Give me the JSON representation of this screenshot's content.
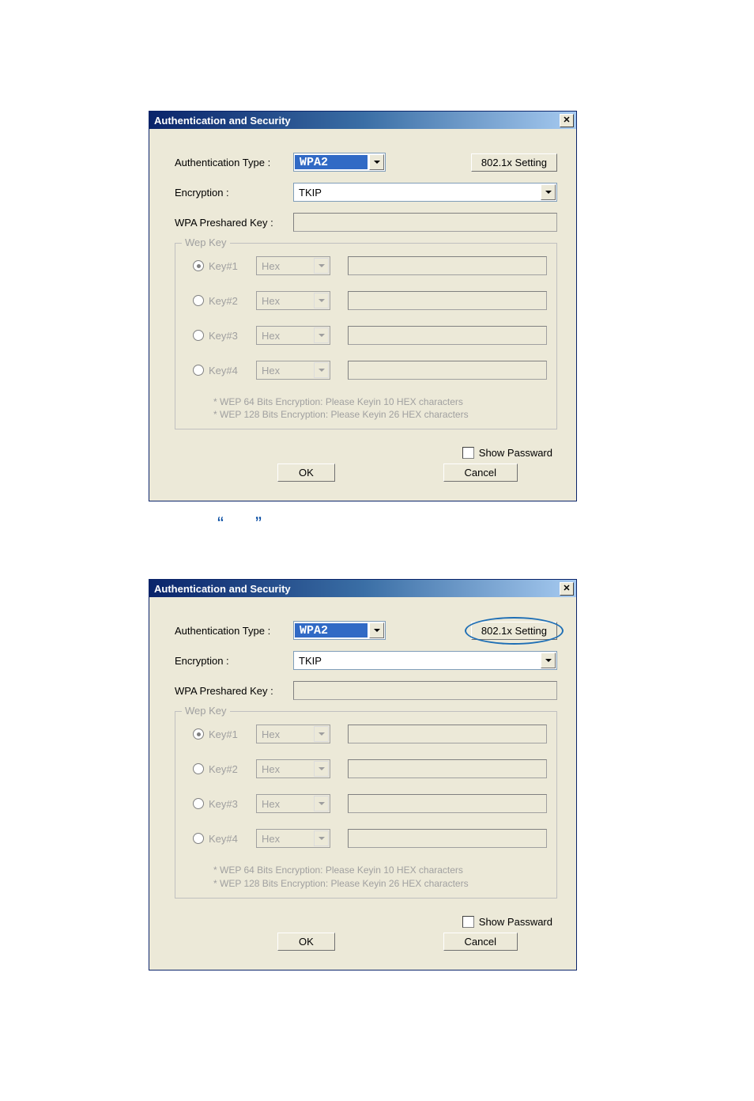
{
  "decor_quotes": {
    "left": "“",
    "right": "”"
  },
  "dialogs": [
    {
      "title": "Authentication and Security",
      "highlight_8021x": false,
      "labels": {
        "auth_type": "Authentication Type :",
        "encryption": "Encryption :",
        "psk": "WPA Preshared Key :",
        "wep_legend": "Wep Key",
        "show_password": "Show Passward",
        "btn_8021x": "802.1x Setting",
        "ok": "OK",
        "cancel": "Cancel"
      },
      "values": {
        "auth_type": "WPA2",
        "encryption": "TKIP",
        "psk": "",
        "show_password_checked": false,
        "selected_wep_index": 0
      },
      "wep_keys": [
        {
          "label": "Key#1",
          "format": "Hex",
          "value": ""
        },
        {
          "label": "Key#2",
          "format": "Hex",
          "value": ""
        },
        {
          "label": "Key#3",
          "format": "Hex",
          "value": ""
        },
        {
          "label": "Key#4",
          "format": "Hex",
          "value": ""
        }
      ],
      "wep_notes": [
        "* WEP 64 Bits Encryption:   Please Keyin 10 HEX characters",
        "* WEP 128 Bits Encryption:   Please Keyin 26 HEX characters"
      ]
    },
    {
      "title": "Authentication and Security",
      "highlight_8021x": true,
      "labels": {
        "auth_type": "Authentication Type :",
        "encryption": "Encryption :",
        "psk": "WPA Preshared Key :",
        "wep_legend": "Wep Key",
        "show_password": "Show Passward",
        "btn_8021x": "802.1x Setting",
        "ok": "OK",
        "cancel": "Cancel"
      },
      "values": {
        "auth_type": "WPA2",
        "encryption": "TKIP",
        "psk": "",
        "show_password_checked": false,
        "selected_wep_index": 0
      },
      "wep_keys": [
        {
          "label": "Key#1",
          "format": "Hex",
          "value": ""
        },
        {
          "label": "Key#2",
          "format": "Hex",
          "value": ""
        },
        {
          "label": "Key#3",
          "format": "Hex",
          "value": ""
        },
        {
          "label": "Key#4",
          "format": "Hex",
          "value": ""
        }
      ],
      "wep_notes": [
        "* WEP 64 Bits Encryption:   Please Keyin 10 HEX characters",
        "* WEP 128 Bits Encryption:   Please Keyin 26 HEX characters"
      ]
    }
  ]
}
